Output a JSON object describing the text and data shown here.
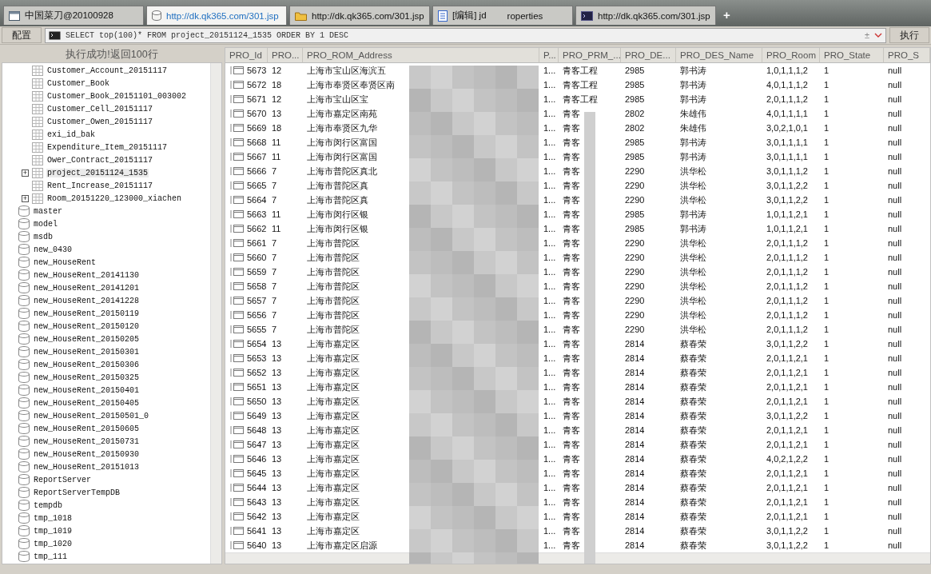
{
  "tabs": [
    {
      "label": "中国菜刀@20100928",
      "selected": false
    },
    {
      "label": "http://dk.qk365.com/301.jsp",
      "selected": true
    },
    {
      "label": "http://dk.qk365.com/301.jsp",
      "selected": false
    },
    {
      "label": "[编辑] jd",
      "tail": "roperties",
      "selected": false
    },
    {
      "label": "http://dk.qk365.com/301.jsp",
      "selected": false
    }
  ],
  "new_tab": "+",
  "toolbar": {
    "config_button": "配置",
    "query": "SELECT top(100)* FROM project_20151124_1535 ORDER BY 1 DESC",
    "history_symbol": "±",
    "run_button": "执行"
  },
  "status": "执行成功!返回100行",
  "tree": [
    {
      "label": "Customer_Account_20151117",
      "kind": "table",
      "expandable": false,
      "selected": false
    },
    {
      "label": "Customer_Book",
      "kind": "table",
      "expandable": false,
      "selected": false
    },
    {
      "label": "Customer_Book_20151101_003002",
      "kind": "table",
      "expandable": false,
      "selected": false
    },
    {
      "label": "Customer_Cell_20151117",
      "kind": "table",
      "expandable": false,
      "selected": false
    },
    {
      "label": "Customer_Owen_20151117",
      "kind": "table",
      "expandable": false,
      "selected": false
    },
    {
      "label": "exi_id_bak",
      "kind": "table",
      "expandable": false,
      "selected": false
    },
    {
      "label": "Expenditure_Item_20151117",
      "kind": "table",
      "expandable": false,
      "selected": false
    },
    {
      "label": "Ower_Contract_20151117",
      "kind": "table",
      "expandable": false,
      "selected": false
    },
    {
      "label": "project_20151124_1535",
      "kind": "table",
      "expandable": true,
      "expander": "+",
      "selected": true
    },
    {
      "label": "Rent_Increase_20151117",
      "kind": "table",
      "expandable": false,
      "selected": false
    },
    {
      "label": "Room_20151220_123000_xiachen",
      "kind": "table",
      "expandable": true,
      "expander": "+",
      "selected": false
    },
    {
      "label": "master",
      "kind": "database",
      "expandable": false,
      "selected": false
    },
    {
      "label": "model",
      "kind": "database",
      "expandable": false,
      "selected": false
    },
    {
      "label": "msdb",
      "kind": "database",
      "expandable": false,
      "selected": false
    },
    {
      "label": "new_0430",
      "kind": "database",
      "expandable": false,
      "selected": false
    },
    {
      "label": "new_HouseRent",
      "kind": "database",
      "expandable": false,
      "selected": false
    },
    {
      "label": "new_HouseRent_20141130",
      "kind": "database",
      "expandable": false,
      "selected": false
    },
    {
      "label": "new_HouseRent_20141201",
      "kind": "database",
      "expandable": false,
      "selected": false
    },
    {
      "label": "new_HouseRent_20141228",
      "kind": "database",
      "expandable": false,
      "selected": false
    },
    {
      "label": "new_HouseRent_20150119",
      "kind": "database",
      "expandable": false,
      "selected": false
    },
    {
      "label": "new_HouseRent_20150120",
      "kind": "database",
      "expandable": false,
      "selected": false
    },
    {
      "label": "new_HouseRent_20150205",
      "kind": "database",
      "expandable": false,
      "selected": false
    },
    {
      "label": "new_HouseRent_20150301",
      "kind": "database",
      "expandable": false,
      "selected": false
    },
    {
      "label": "new_HouseRent_20150306",
      "kind": "database",
      "expandable": false,
      "selected": false
    },
    {
      "label": "new_HouseRent_20150325",
      "kind": "database",
      "expandable": false,
      "selected": false
    },
    {
      "label": "new_HouseRent_20150401",
      "kind": "database",
      "expandable": false,
      "selected": false
    },
    {
      "label": "new_HouseRent_20150405",
      "kind": "database",
      "expandable": false,
      "selected": false
    },
    {
      "label": "new_HouseRent_20150501_0",
      "kind": "database",
      "expandable": false,
      "selected": false
    },
    {
      "label": "new_HouseRent_20150605",
      "kind": "database",
      "expandable": false,
      "selected": false
    },
    {
      "label": "new_HouseRent_20150731",
      "kind": "database",
      "expandable": false,
      "selected": false
    },
    {
      "label": "new_HouseRent_20150930",
      "kind": "database",
      "expandable": false,
      "selected": false
    },
    {
      "label": "new_HouseRent_20151013",
      "kind": "database",
      "expandable": false,
      "selected": false
    },
    {
      "label": "ReportServer",
      "kind": "database",
      "expandable": false,
      "selected": false
    },
    {
      "label": "ReportServerTempDB",
      "kind": "database",
      "expandable": false,
      "selected": false
    },
    {
      "label": "tempdb",
      "kind": "database",
      "expandable": false,
      "selected": false
    },
    {
      "label": "tmp_1018",
      "kind": "database",
      "expandable": false,
      "selected": false
    },
    {
      "label": "tmp_1019",
      "kind": "database",
      "expandable": false,
      "selected": false
    },
    {
      "label": "tmp_1020",
      "kind": "database",
      "expandable": false,
      "selected": false
    },
    {
      "label": "tmp_111",
      "kind": "database",
      "expandable": false,
      "selected": false
    }
  ],
  "table": {
    "columns": [
      "PRO_Id",
      "PRO...",
      "PRO_ROM_Address",
      "P...",
      "PRO_PRM_...",
      "PRO_DE...",
      "PRO_DES_Name",
      "PRO_Room",
      "PRO_State",
      "PRO_S"
    ],
    "rows": [
      [
        "5673",
        "12",
        "上海市宝山区海滨五",
        "1...",
        "青客工程",
        "2985",
        "郭书涛",
        "1,0,1,1,1,2",
        "1",
        "null"
      ],
      [
        "5672",
        "18",
        "上海市奉贤区奉贤区南",
        "1...",
        "青客工程",
        "2985",
        "郭书涛",
        "4,0,1,1,1,2",
        "1",
        "null"
      ],
      [
        "5671",
        "12",
        "上海市宝山区宝",
        "1...",
        "青客工程",
        "2985",
        "郭书涛",
        "2,0,1,1,1,2",
        "1",
        "null"
      ],
      [
        "5670",
        "13",
        "上海市嘉定区南苑",
        "1...",
        "青客",
        "2802",
        "朱雄伟",
        "4,0,1,1,1,1",
        "1",
        "null"
      ],
      [
        "5669",
        "18",
        "上海市奉贤区九华",
        "1...",
        "青客",
        "2802",
        "朱雄伟",
        "3,0,2,1,0,1",
        "1",
        "null"
      ],
      [
        "5668",
        "11",
        "上海市闵行区富国",
        "1...",
        "青客",
        "2985",
        "郭书涛",
        "3,0,1,1,1,1",
        "1",
        "null"
      ],
      [
        "5667",
        "11",
        "上海市闵行区富国",
        "1...",
        "青客",
        "2985",
        "郭书涛",
        "3,0,1,1,1,1",
        "1",
        "null"
      ],
      [
        "5666",
        "7",
        "上海市普陀区真北",
        "1...",
        "青客",
        "2290",
        "洪华松",
        "3,0,1,1,1,2",
        "1",
        "null"
      ],
      [
        "5665",
        "7",
        "上海市普陀区真",
        "1...",
        "青客",
        "2290",
        "洪华松",
        "3,0,1,1,2,2",
        "1",
        "null"
      ],
      [
        "5664",
        "7",
        "上海市普陀区真",
        "1...",
        "青客",
        "2290",
        "洪华松",
        "3,0,1,1,2,2",
        "1",
        "null"
      ],
      [
        "5663",
        "11",
        "上海市闵行区银",
        "1...",
        "青客",
        "2985",
        "郭书涛",
        "1,0,1,1,2,1",
        "1",
        "null"
      ],
      [
        "5662",
        "11",
        "上海市闵行区银",
        "1...",
        "青客",
        "2985",
        "郭书涛",
        "1,0,1,1,2,1",
        "1",
        "null"
      ],
      [
        "5661",
        "7",
        "上海市普陀区",
        "1...",
        "青客",
        "2290",
        "洪华松",
        "2,0,1,1,1,2",
        "1",
        "null"
      ],
      [
        "5660",
        "7",
        "上海市普陀区",
        "1...",
        "青客",
        "2290",
        "洪华松",
        "2,0,1,1,1,2",
        "1",
        "null"
      ],
      [
        "5659",
        "7",
        "上海市普陀区",
        "1...",
        "青客",
        "2290",
        "洪华松",
        "2,0,1,1,1,2",
        "1",
        "null"
      ],
      [
        "5658",
        "7",
        "上海市普陀区",
        "1...",
        "青客",
        "2290",
        "洪华松",
        "2,0,1,1,1,2",
        "1",
        "null"
      ],
      [
        "5657",
        "7",
        "上海市普陀区",
        "1...",
        "青客",
        "2290",
        "洪华松",
        "2,0,1,1,1,2",
        "1",
        "null"
      ],
      [
        "5656",
        "7",
        "上海市普陀区",
        "1...",
        "青客",
        "2290",
        "洪华松",
        "2,0,1,1,1,2",
        "1",
        "null"
      ],
      [
        "5655",
        "7",
        "上海市普陀区",
        "1...",
        "青客",
        "2290",
        "洪华松",
        "2,0,1,1,1,2",
        "1",
        "null"
      ],
      [
        "5654",
        "13",
        "上海市嘉定区",
        "1...",
        "青客",
        "2814",
        "蔡春荣",
        "3,0,1,1,2,2",
        "1",
        "null"
      ],
      [
        "5653",
        "13",
        "上海市嘉定区",
        "1...",
        "青客",
        "2814",
        "蔡春荣",
        "2,0,1,1,2,1",
        "1",
        "null"
      ],
      [
        "5652",
        "13",
        "上海市嘉定区",
        "1...",
        "青客",
        "2814",
        "蔡春荣",
        "2,0,1,1,2,1",
        "1",
        "null"
      ],
      [
        "5651",
        "13",
        "上海市嘉定区",
        "1...",
        "青客",
        "2814",
        "蔡春荣",
        "2,0,1,1,2,1",
        "1",
        "null"
      ],
      [
        "5650",
        "13",
        "上海市嘉定区",
        "1...",
        "青客",
        "2814",
        "蔡春荣",
        "2,0,1,1,2,1",
        "1",
        "null"
      ],
      [
        "5649",
        "13",
        "上海市嘉定区",
        "1...",
        "青客",
        "2814",
        "蔡春荣",
        "3,0,1,1,2,2",
        "1",
        "null"
      ],
      [
        "5648",
        "13",
        "上海市嘉定区",
        "1...",
        "青客",
        "2814",
        "蔡春荣",
        "2,0,1,1,2,1",
        "1",
        "null"
      ],
      [
        "5647",
        "13",
        "上海市嘉定区",
        "1...",
        "青客",
        "2814",
        "蔡春荣",
        "2,0,1,1,2,1",
        "1",
        "null"
      ],
      [
        "5646",
        "13",
        "上海市嘉定区",
        "1...",
        "青客",
        "2814",
        "蔡春荣",
        "4,0,2,1,2,2",
        "1",
        "null"
      ],
      [
        "5645",
        "13",
        "上海市嘉定区",
        "1...",
        "青客",
        "2814",
        "蔡春荣",
        "2,0,1,1,2,1",
        "1",
        "null"
      ],
      [
        "5644",
        "13",
        "上海市嘉定区",
        "1...",
        "青客",
        "2814",
        "蔡春荣",
        "2,0,1,1,2,1",
        "1",
        "null"
      ],
      [
        "5643",
        "13",
        "上海市嘉定区",
        "1...",
        "青客",
        "2814",
        "蔡春荣",
        "2,0,1,1,2,1",
        "1",
        "null"
      ],
      [
        "5642",
        "13",
        "上海市嘉定区",
        "1...",
        "青客",
        "2814",
        "蔡春荣",
        "2,0,1,1,2,1",
        "1",
        "null"
      ],
      [
        "5641",
        "13",
        "上海市嘉定区",
        "1...",
        "青客",
        "2814",
        "蔡春荣",
        "3,0,1,1,2,2",
        "1",
        "null"
      ],
      [
        "5640",
        "13",
        "上海市嘉定区启源",
        "1...",
        "青客",
        "2814",
        "蔡春荣",
        "3,0,1,1,2,2",
        "1",
        "null"
      ]
    ]
  }
}
